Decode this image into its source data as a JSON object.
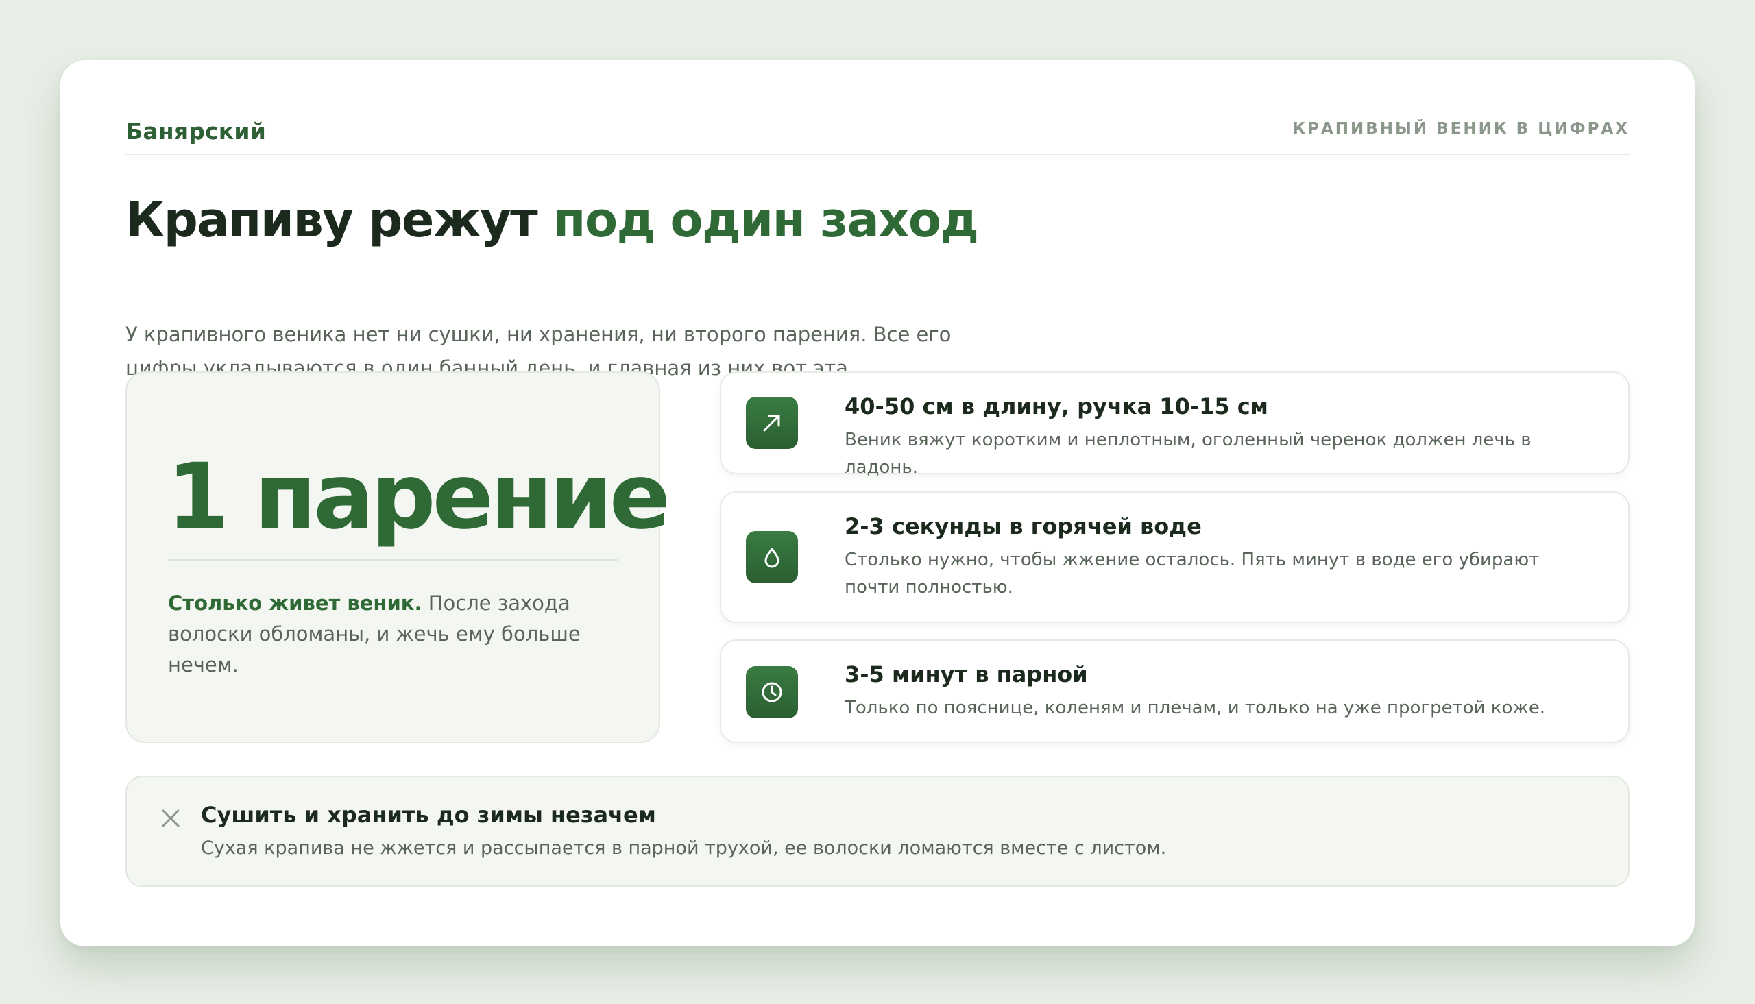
{
  "header": {
    "brand": "Банярский",
    "kicker": "КРАПИВНЫЙ ВЕНИК В ЦИФРАХ"
  },
  "headline": {
    "part1": "Крапиву режут ",
    "accent": "под один заход"
  },
  "lead": "У крапивного веника нет ни сушки, ни хранения, ни второго парения. Все его цифры укладываются в один банный день, и главная из них вот эта.",
  "hero": {
    "number": "1 парение",
    "desc_bold": "Столько живет веник.",
    "desc_rest": " После захода волоски обломаны, и жечь ему больше нечем."
  },
  "facts": [
    {
      "icon": "arrow-up-right-icon",
      "title": "40-50 см в длину, ручка 10-15 см",
      "desc": "Веник вяжут коротким и неплотным, оголенный черенок должен лечь в ладонь."
    },
    {
      "icon": "water-drop-icon",
      "title": "2-3 секунды в горячей воде",
      "desc": "Столько нужно, чтобы жжение осталось. Пять минут в воде его убирают почти полностью."
    },
    {
      "icon": "clock-icon",
      "title": "3-5 минут в парной",
      "desc": "Только по пояснице, коленям и плечам, и только на уже прогретой коже."
    }
  ],
  "note": {
    "icon": "close-icon",
    "title": "Сушить и хранить до зимы незачем",
    "desc": "Сухая крапива не жжется и рассыпается в парной трухой, ее волоски ломаются вместе с листом."
  },
  "colors": {
    "accent": "#2f6a36",
    "background": "#e9efe7",
    "card": "#ffffff",
    "panel": "#f3f6f1"
  }
}
